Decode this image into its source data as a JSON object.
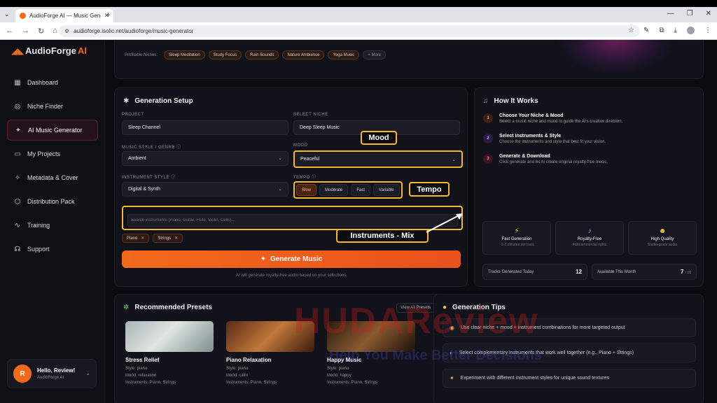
{
  "browser": {
    "tab_title": "AudioForge AI — Music Genera",
    "url": "audioforge.isolic.net/audioforge/music-generator"
  },
  "app": {
    "logo_main": "AudioForge",
    "logo_ai": "AI"
  },
  "sidebar": {
    "items": [
      {
        "label": "Dashboard"
      },
      {
        "label": "Niche Finder"
      },
      {
        "label": "AI Music Generator"
      },
      {
        "label": "My Projects"
      },
      {
        "label": "Metadata & Cover"
      },
      {
        "label": "Distribution Pack"
      },
      {
        "label": "Training"
      },
      {
        "label": "Support"
      }
    ],
    "user": {
      "initial": "R",
      "greeting": "Hello, Review!",
      "sub": "AudioForge AI"
    }
  },
  "hero": {
    "niches_label": "Profitable Niches:",
    "niches": [
      "Sleep Meditation",
      "Study Focus",
      "Rain Sounds",
      "Nature Ambience",
      "Yoga Music"
    ],
    "more": "+ More"
  },
  "setup": {
    "title": "Generation Setup",
    "project_label": "PROJECT",
    "project_value": "Sleep Channel",
    "niche_label": "SELECT NICHE",
    "niche_value": "Deep Sleep Music",
    "style_label": "MUSIC STYLE / GENRE",
    "style_value": "Ambient",
    "mood_label": "MOOD",
    "mood_value": "Peaceful",
    "instr_style_label": "INSTRUMENT STYLE",
    "instr_style_value": "Digital & Synth",
    "tempo_label": "TEMPO",
    "tempo_options": [
      "Slow",
      "Moderate",
      "Fast",
      "Variable"
    ],
    "instruments_placeholder": "Search instruments (Piano, Guitar, Flute, Violin, Cello)...",
    "tags": [
      "Piano",
      "Strings"
    ],
    "generate_label": "Generate Music",
    "note": "AI will generate royalty-free audio based on your selections."
  },
  "callouts": {
    "mood": "Mood",
    "tempo": "Tempo",
    "instruments": "Instruments - Mix"
  },
  "how": {
    "title": "How It Works",
    "steps": [
      {
        "num": "1",
        "title": "Choose Your Niche & Mood",
        "desc": "Select a music niche and mood to guide the AI's creative direction."
      },
      {
        "num": "2",
        "title": "Select Instruments & Style",
        "desc": "Choose the instruments and style that best fit your vision."
      },
      {
        "num": "3",
        "title": "Generate & Download",
        "desc": "Click generate and let AI create original royalty-free music."
      }
    ],
    "features": [
      {
        "title": "Fast Generation",
        "sub": "~2-3 minutes per track"
      },
      {
        "title": "Royalty-Free",
        "sub": "Full commercial rights"
      },
      {
        "title": "High Quality",
        "sub": "Studio-grade audio"
      }
    ],
    "stats": [
      {
        "label": "Tracks Generated Today",
        "value": "12"
      },
      {
        "label": "Available This Month",
        "value": "7",
        "of": "/ 10"
      }
    ]
  },
  "presets": {
    "title": "Recommended Presets",
    "view_all": "View All Presets",
    "items": [
      {
        "title": "Stress Relief",
        "style": "Style: piano",
        "mood": "Mood: relaxation",
        "instruments": "Instruments: Piano, Strings"
      },
      {
        "title": "Piano Relaxation",
        "style": "Style: piano",
        "mood": "Mood: calm",
        "instruments": "Instruments: Piano, Strings"
      },
      {
        "title": "Happy Music",
        "style": "Style: piano",
        "mood": "Mood: happy",
        "instruments": "Instruments: Piano, Strings"
      }
    ]
  },
  "tips": {
    "title": "Generation Tips",
    "items": [
      "Use clear niche + mood + instrument combinations for more targeted output",
      "Select complementary instruments that work well together (e.g., Piano + Strings)",
      "Experiment with different instrument styles for unique sound textures"
    ]
  },
  "watermark": {
    "main": "HUDAReview",
    "sub": "Help You Make Better Decisions"
  }
}
